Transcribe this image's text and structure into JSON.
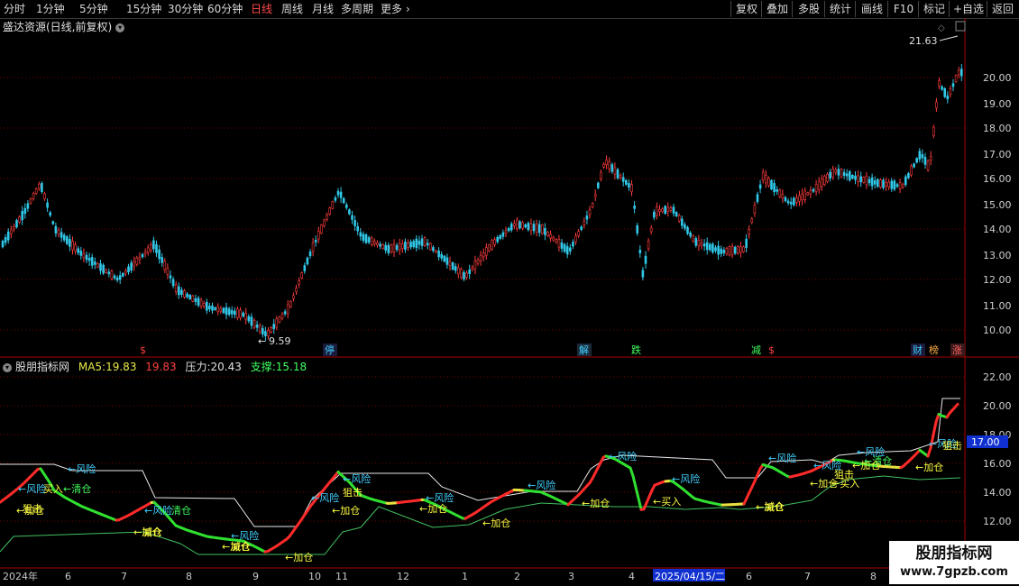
{
  "toolbar": {
    "periods": [
      "分时",
      "1分钟",
      "5分钟",
      "15分钟",
      "30分钟",
      "60分钟",
      "日线",
      "周线",
      "月线",
      "多周期",
      "更多"
    ],
    "active_period": "日线",
    "more_icon": "chevron-right-icon",
    "right_buttons": [
      "复权",
      "叠加",
      "多股",
      "统计",
      "画线",
      "F10",
      "标记",
      "+自选",
      "返回"
    ]
  },
  "main_chart": {
    "title": "盛达资源(日线,前复权)",
    "price_axis": [
      "20.00",
      "19.00",
      "18.00",
      "17.00",
      "16.00",
      "15.00",
      "14.00",
      "13.00",
      "12.00",
      "11.00",
      "10.00"
    ],
    "high_label": "21.63",
    "low_label": "9.59",
    "event_markers": [
      "$",
      "停",
      "解",
      "跌",
      "减",
      "$",
      "财",
      "榜",
      "涨"
    ],
    "colors": {
      "up": "#ff3c3c",
      "down": "#30c8e8",
      "grid": "#7a0000"
    }
  },
  "indicator": {
    "name": "股朋指标网",
    "ma5_label": "MA5:",
    "ma5_value": "19.83",
    "ma5_value2": "19.83",
    "pressure_label": "压力:",
    "pressure_value": "20.43",
    "support_label": "支撑:",
    "support_value": "15.18",
    "price_axis": [
      "22.00",
      "20.00",
      "18.00",
      "16.00",
      "14.00",
      "12.00"
    ],
    "current_price": "17.00",
    "signals": {
      "risk": "←风险",
      "buy": "买入",
      "buy_arrow": "←买入",
      "add": "←加仓",
      "clear": "清仓",
      "clear_arrow": "←清仓",
      "snipe": "狙击",
      "reduce": "减仓"
    }
  },
  "date_axis": {
    "labels": [
      "2024年",
      "6",
      "7",
      "8",
      "9",
      "10",
      "11",
      "12",
      "1",
      "2",
      "3",
      "4",
      "2025/04/15/二",
      "6",
      "7",
      "8"
    ]
  },
  "watermark": {
    "line1": "股朋指标网",
    "line2": "www.7gpzb.com"
  }
}
